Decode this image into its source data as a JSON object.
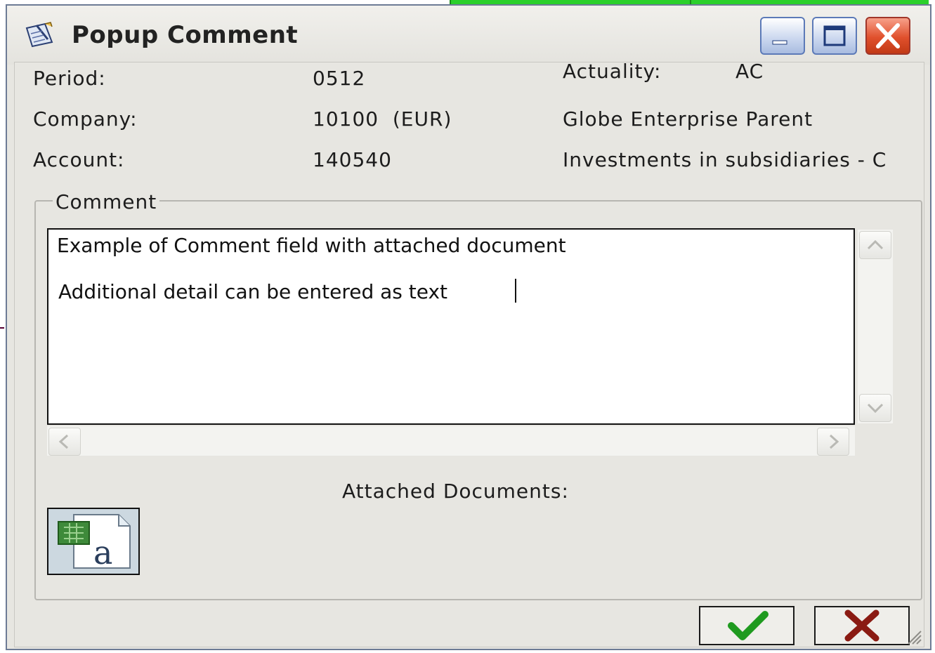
{
  "window": {
    "title": "Popup Comment",
    "controls": {
      "minimize": "minimize-icon",
      "maximize": "maximize-icon",
      "close": "close-icon"
    }
  },
  "header": {
    "period_label": "Period:",
    "period_value": "0512",
    "actuality_label": "Actuality:",
    "actuality_value": "AC",
    "company_label": "Company:",
    "company_value": "10100  (EUR)",
    "company_name": "Globe Enterprise Parent",
    "account_label": "Account:",
    "account_value": "140540",
    "account_name": "Investments in subsidiaries - C"
  },
  "comment": {
    "legend": "Comment",
    "line1": "Example of Comment field with attached document",
    "line2": "Additional detail can be entered as text"
  },
  "attachments": {
    "label": "Attached Documents:",
    "items": [
      {
        "icon": "excel-document-icon"
      }
    ]
  },
  "footer": {
    "ok_icon": "checkmark-icon",
    "cancel_icon": "red-x-icon"
  },
  "colors": {
    "close_button": "#e0502c",
    "ok_check": "#1f9a1f",
    "cancel_x": "#8a1a12",
    "background_bar": "#2bd02b"
  }
}
